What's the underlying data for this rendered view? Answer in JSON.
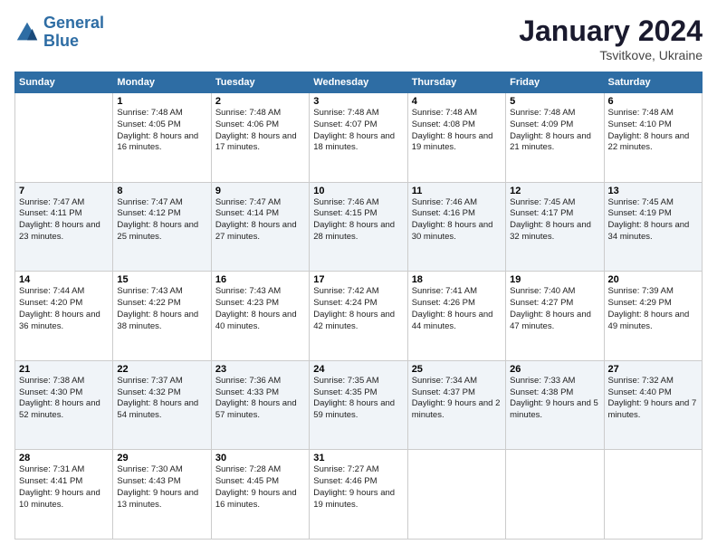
{
  "logo": {
    "line1": "General",
    "line2": "Blue"
  },
  "title": "January 2024",
  "subtitle": "Tsvitkove, Ukraine",
  "days_of_week": [
    "Sunday",
    "Monday",
    "Tuesday",
    "Wednesday",
    "Thursday",
    "Friday",
    "Saturday"
  ],
  "weeks": [
    [
      {
        "day": "",
        "sunrise": "",
        "sunset": "",
        "daylight": ""
      },
      {
        "day": "1",
        "sunrise": "Sunrise: 7:48 AM",
        "sunset": "Sunset: 4:05 PM",
        "daylight": "Daylight: 8 hours and 16 minutes."
      },
      {
        "day": "2",
        "sunrise": "Sunrise: 7:48 AM",
        "sunset": "Sunset: 4:06 PM",
        "daylight": "Daylight: 8 hours and 17 minutes."
      },
      {
        "day": "3",
        "sunrise": "Sunrise: 7:48 AM",
        "sunset": "Sunset: 4:07 PM",
        "daylight": "Daylight: 8 hours and 18 minutes."
      },
      {
        "day": "4",
        "sunrise": "Sunrise: 7:48 AM",
        "sunset": "Sunset: 4:08 PM",
        "daylight": "Daylight: 8 hours and 19 minutes."
      },
      {
        "day": "5",
        "sunrise": "Sunrise: 7:48 AM",
        "sunset": "Sunset: 4:09 PM",
        "daylight": "Daylight: 8 hours and 21 minutes."
      },
      {
        "day": "6",
        "sunrise": "Sunrise: 7:48 AM",
        "sunset": "Sunset: 4:10 PM",
        "daylight": "Daylight: 8 hours and 22 minutes."
      }
    ],
    [
      {
        "day": "7",
        "sunrise": "Sunrise: 7:47 AM",
        "sunset": "Sunset: 4:11 PM",
        "daylight": "Daylight: 8 hours and 23 minutes."
      },
      {
        "day": "8",
        "sunrise": "Sunrise: 7:47 AM",
        "sunset": "Sunset: 4:12 PM",
        "daylight": "Daylight: 8 hours and 25 minutes."
      },
      {
        "day": "9",
        "sunrise": "Sunrise: 7:47 AM",
        "sunset": "Sunset: 4:14 PM",
        "daylight": "Daylight: 8 hours and 27 minutes."
      },
      {
        "day": "10",
        "sunrise": "Sunrise: 7:46 AM",
        "sunset": "Sunset: 4:15 PM",
        "daylight": "Daylight: 8 hours and 28 minutes."
      },
      {
        "day": "11",
        "sunrise": "Sunrise: 7:46 AM",
        "sunset": "Sunset: 4:16 PM",
        "daylight": "Daylight: 8 hours and 30 minutes."
      },
      {
        "day": "12",
        "sunrise": "Sunrise: 7:45 AM",
        "sunset": "Sunset: 4:17 PM",
        "daylight": "Daylight: 8 hours and 32 minutes."
      },
      {
        "day": "13",
        "sunrise": "Sunrise: 7:45 AM",
        "sunset": "Sunset: 4:19 PM",
        "daylight": "Daylight: 8 hours and 34 minutes."
      }
    ],
    [
      {
        "day": "14",
        "sunrise": "Sunrise: 7:44 AM",
        "sunset": "Sunset: 4:20 PM",
        "daylight": "Daylight: 8 hours and 36 minutes."
      },
      {
        "day": "15",
        "sunrise": "Sunrise: 7:43 AM",
        "sunset": "Sunset: 4:22 PM",
        "daylight": "Daylight: 8 hours and 38 minutes."
      },
      {
        "day": "16",
        "sunrise": "Sunrise: 7:43 AM",
        "sunset": "Sunset: 4:23 PM",
        "daylight": "Daylight: 8 hours and 40 minutes."
      },
      {
        "day": "17",
        "sunrise": "Sunrise: 7:42 AM",
        "sunset": "Sunset: 4:24 PM",
        "daylight": "Daylight: 8 hours and 42 minutes."
      },
      {
        "day": "18",
        "sunrise": "Sunrise: 7:41 AM",
        "sunset": "Sunset: 4:26 PM",
        "daylight": "Daylight: 8 hours and 44 minutes."
      },
      {
        "day": "19",
        "sunrise": "Sunrise: 7:40 AM",
        "sunset": "Sunset: 4:27 PM",
        "daylight": "Daylight: 8 hours and 47 minutes."
      },
      {
        "day": "20",
        "sunrise": "Sunrise: 7:39 AM",
        "sunset": "Sunset: 4:29 PM",
        "daylight": "Daylight: 8 hours and 49 minutes."
      }
    ],
    [
      {
        "day": "21",
        "sunrise": "Sunrise: 7:38 AM",
        "sunset": "Sunset: 4:30 PM",
        "daylight": "Daylight: 8 hours and 52 minutes."
      },
      {
        "day": "22",
        "sunrise": "Sunrise: 7:37 AM",
        "sunset": "Sunset: 4:32 PM",
        "daylight": "Daylight: 8 hours and 54 minutes."
      },
      {
        "day": "23",
        "sunrise": "Sunrise: 7:36 AM",
        "sunset": "Sunset: 4:33 PM",
        "daylight": "Daylight: 8 hours and 57 minutes."
      },
      {
        "day": "24",
        "sunrise": "Sunrise: 7:35 AM",
        "sunset": "Sunset: 4:35 PM",
        "daylight": "Daylight: 8 hours and 59 minutes."
      },
      {
        "day": "25",
        "sunrise": "Sunrise: 7:34 AM",
        "sunset": "Sunset: 4:37 PM",
        "daylight": "Daylight: 9 hours and 2 minutes."
      },
      {
        "day": "26",
        "sunrise": "Sunrise: 7:33 AM",
        "sunset": "Sunset: 4:38 PM",
        "daylight": "Daylight: 9 hours and 5 minutes."
      },
      {
        "day": "27",
        "sunrise": "Sunrise: 7:32 AM",
        "sunset": "Sunset: 4:40 PM",
        "daylight": "Daylight: 9 hours and 7 minutes."
      }
    ],
    [
      {
        "day": "28",
        "sunrise": "Sunrise: 7:31 AM",
        "sunset": "Sunset: 4:41 PM",
        "daylight": "Daylight: 9 hours and 10 minutes."
      },
      {
        "day": "29",
        "sunrise": "Sunrise: 7:30 AM",
        "sunset": "Sunset: 4:43 PM",
        "daylight": "Daylight: 9 hours and 13 minutes."
      },
      {
        "day": "30",
        "sunrise": "Sunrise: 7:28 AM",
        "sunset": "Sunset: 4:45 PM",
        "daylight": "Daylight: 9 hours and 16 minutes."
      },
      {
        "day": "31",
        "sunrise": "Sunrise: 7:27 AM",
        "sunset": "Sunset: 4:46 PM",
        "daylight": "Daylight: 9 hours and 19 minutes."
      },
      {
        "day": "",
        "sunrise": "",
        "sunset": "",
        "daylight": ""
      },
      {
        "day": "",
        "sunrise": "",
        "sunset": "",
        "daylight": ""
      },
      {
        "day": "",
        "sunrise": "",
        "sunset": "",
        "daylight": ""
      }
    ]
  ]
}
